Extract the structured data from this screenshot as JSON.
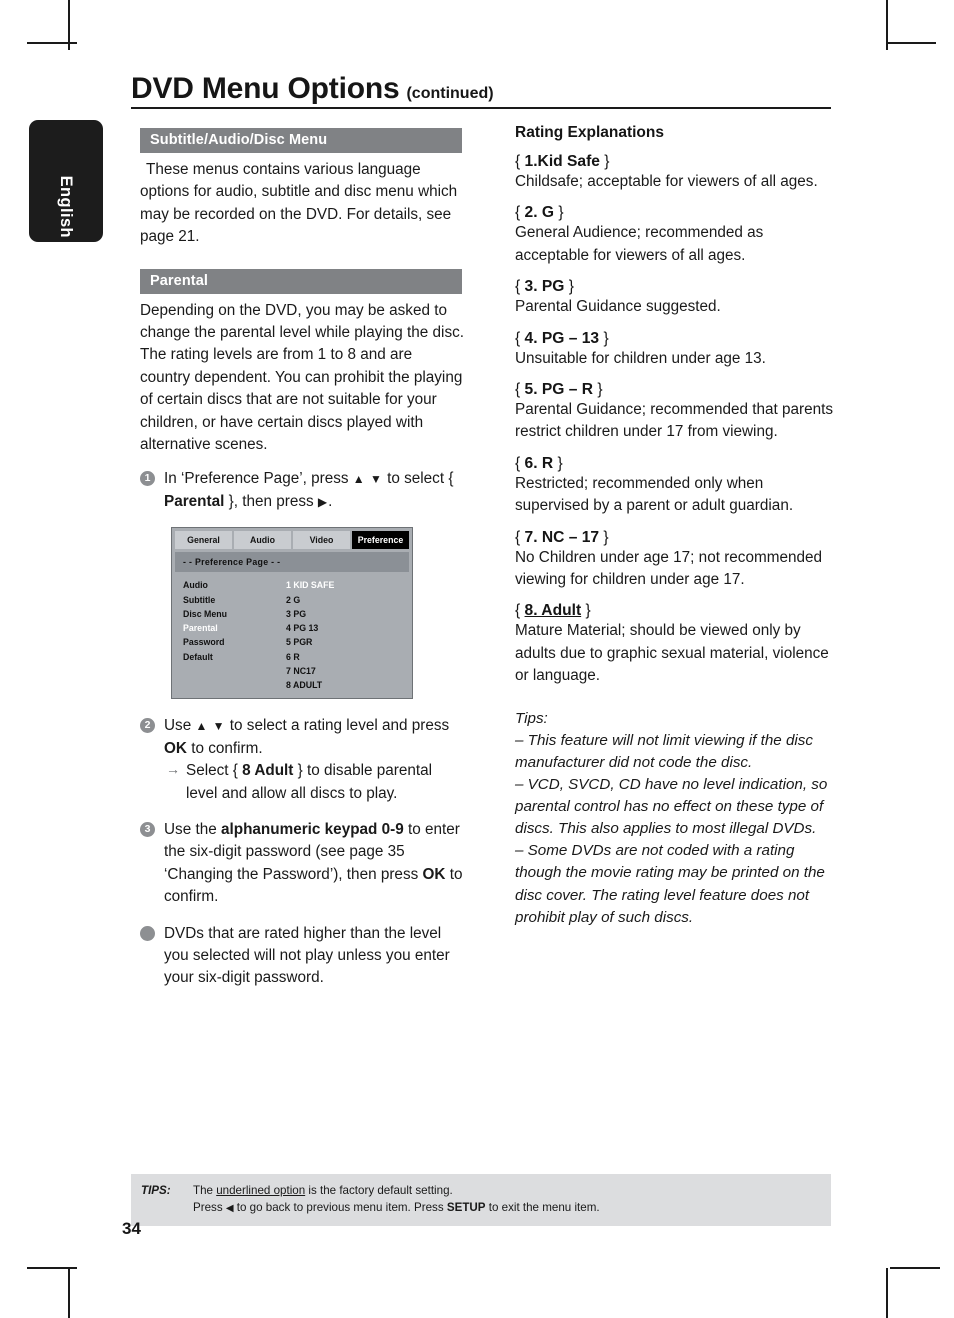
{
  "page": {
    "language_tab": "English",
    "title_main": "DVD Menu Options",
    "title_continued": "(continued)",
    "page_number": "34"
  },
  "left_column": {
    "section1": {
      "heading": "Subtitle/Audio/Disc Menu",
      "body": "These menus contains various language options for audio, subtitle and disc menu which may be recorded on the DVD. For details, see page 21."
    },
    "section2": {
      "heading": "Parental",
      "body": "Depending on the DVD, you may be asked to change the parental level while playing the disc. The rating levels are from 1 to 8 and are country dependent. You can prohibit the playing of certain discs that are not suitable for your children, or have certain discs played with alternative scenes."
    },
    "steps": [
      {
        "marker": "1",
        "text_1": "In ‘Preference Page’, press ",
        "triangles": "▲ ▼",
        "text_2": " to select { ",
        "bold_1": "Parental",
        "text_3": " }, then press ",
        "arrow": "▶",
        "text_4": "."
      },
      {
        "marker": "2",
        "text_1": "Use ",
        "triangles": "▲ ▼",
        "text_2": " to select a rating level and press ",
        "bold_1": "OK",
        "text_3": " to confirm.",
        "sub_arrow": "→",
        "sub_text_1": "Select { ",
        "sub_bold": "8 Adult",
        "sub_text_2": " } to disable parental level and allow all discs to play."
      },
      {
        "marker": "3",
        "text_1": "Use the ",
        "bold_1": "alphanumeric keypad 0-9",
        "text_2": " to enter the six-digit password (see page 35 ‘Changing the Password’), then press ",
        "bold_2": "OK",
        "text_3": " to confirm."
      },
      {
        "marker": "•",
        "text_1": "DVDs that are rated higher than the level you selected will not play unless you enter your six-digit password."
      }
    ],
    "tv_menu": {
      "tabs": [
        {
          "label": "General",
          "active": false
        },
        {
          "label": "Audio",
          "active": false
        },
        {
          "label": "Video",
          "active": false
        },
        {
          "label": "Preference",
          "active": true
        }
      ],
      "page_title": "- -  Preference Page   - -",
      "menu_items": [
        {
          "label": "Audio",
          "selected": false
        },
        {
          "label": "Subtitle",
          "selected": false
        },
        {
          "label": "Disc Menu",
          "selected": false
        },
        {
          "label": "Parental",
          "selected": true
        },
        {
          "label": "Password",
          "selected": false
        },
        {
          "label": "Default",
          "selected": false
        }
      ],
      "rating_values": [
        {
          "label": "1 KID SAFE",
          "selected": true
        },
        {
          "label": "2 G",
          "selected": false
        },
        {
          "label": "3 PG",
          "selected": false
        },
        {
          "label": "4 PG 13",
          "selected": false
        },
        {
          "label": "5 PGR",
          "selected": false
        },
        {
          "label": "6 R",
          "selected": false
        },
        {
          "label": "7 NC17",
          "selected": false
        },
        {
          "label": "8 ADULT",
          "selected": false
        }
      ]
    }
  },
  "right_column": {
    "heading": "Rating Explanations",
    "ratings": [
      {
        "name": "1.Kid Safe",
        "underlined": false,
        "description": "Childsafe; acceptable for viewers of all ages."
      },
      {
        "name": "2. G",
        "underlined": false,
        "description": "General Audience; recommended as acceptable for viewers of all ages."
      },
      {
        "name": "3. PG",
        "underlined": false,
        "description": "Parental Guidance suggested."
      },
      {
        "name": "4. PG – 13",
        "underlined": false,
        "description": "Unsuitable for children under age 13."
      },
      {
        "name": "5. PG – R",
        "underlined": false,
        "description": "Parental Guidance; recommended that parents restrict children under 17 from viewing."
      },
      {
        "name": "6. R",
        "underlined": false,
        "description": "Restricted; recommended only when supervised by a parent or adult guardian."
      },
      {
        "name": "7. NC – 17",
        "underlined": false,
        "description": "No Children under age 17; not recommended viewing for children under age 17."
      },
      {
        "name": "8. Adult",
        "underlined": true,
        "description": "Mature Material; should be viewed only by adults due to graphic sexual material, violence or language."
      }
    ],
    "tips_label": "Tips:",
    "tips": [
      "– This feature will not limit viewing if the disc manufacturer did not code the disc.",
      "– VCD, SVCD, CD have no level indication, so parental control has no effect on these type of discs. This also applies to most illegal DVDs.",
      "– Some DVDs are not coded with a rating though the movie rating may be printed on the disc cover. The rating level feature does not prohibit play of such discs."
    ]
  },
  "footer": {
    "label": "TIPS:",
    "line1_a": "The ",
    "line1_underlined": "underlined option",
    "line1_b": " is the factory default setting.",
    "line2_a": "Press ",
    "line2_arrow": "◀",
    "line2_b": " to go back to previous menu item. Press ",
    "line2_bold": "SETUP",
    "line2_c": " to exit the menu item."
  },
  "colors": {
    "section_bar": "#808285",
    "tv_background": "#a9adb2",
    "tv_tab_active": "#000000",
    "footer_background": "#dcdddf",
    "marker": "#8d8f92"
  }
}
